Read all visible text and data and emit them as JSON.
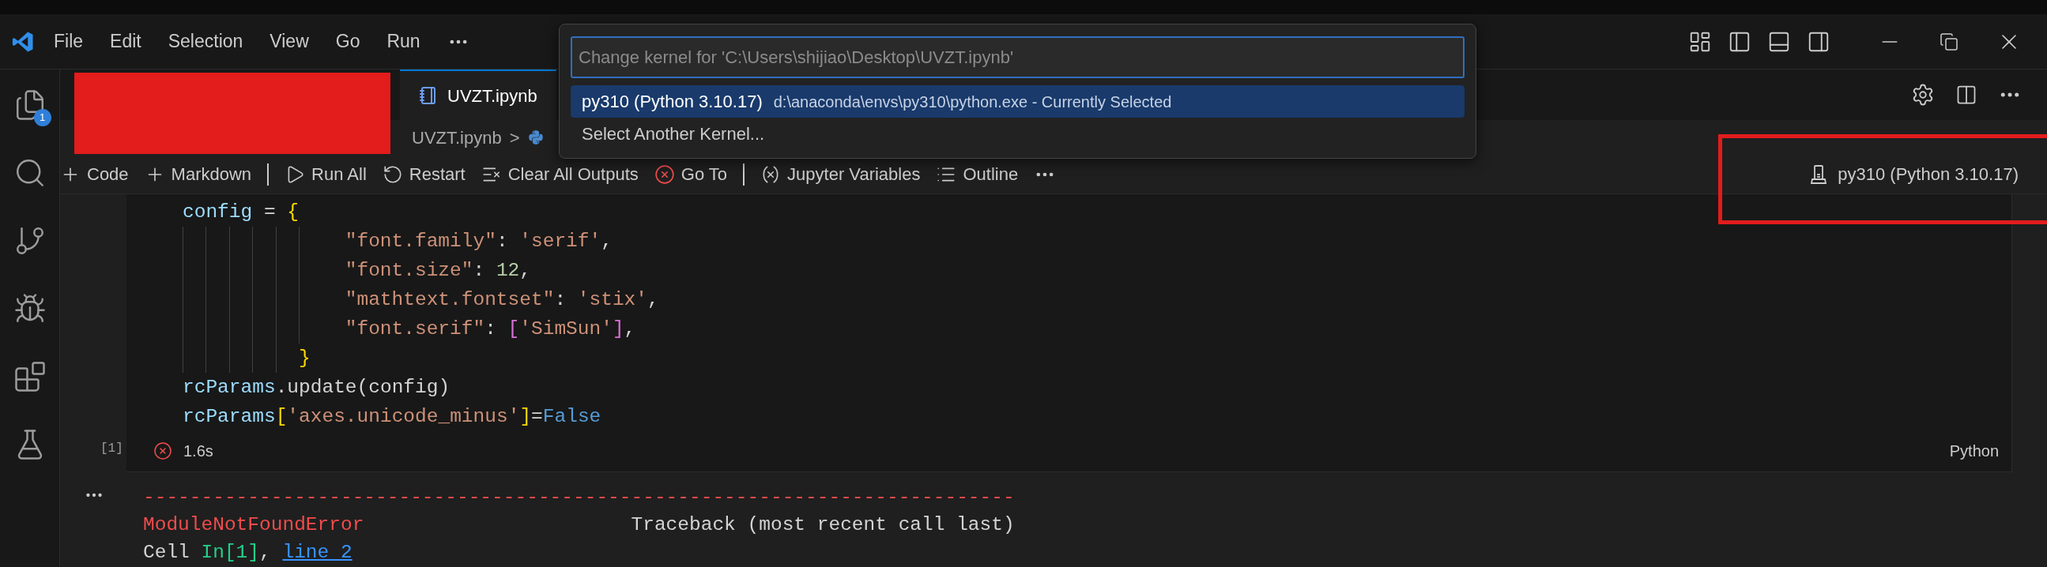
{
  "menu": [
    "File",
    "Edit",
    "Selection",
    "View",
    "Go",
    "Run"
  ],
  "activity_bar": {
    "badge": "1"
  },
  "tab": {
    "label": "UVZT.ipynb",
    "selected": true
  },
  "breadcrumb": [
    "UVZT.ipynb",
    ">"
  ],
  "toolbar": [
    {
      "kind": "button",
      "label": "Code"
    },
    {
      "kind": "button",
      "label": "Markdown"
    },
    {
      "kind": "separator"
    },
    {
      "kind": "button",
      "label": "Run All"
    },
    {
      "kind": "button",
      "label": "Restart"
    },
    {
      "kind": "button",
      "label": "Clear All Outputs"
    },
    {
      "kind": "button",
      "label": "Go To"
    },
    {
      "kind": "separator"
    },
    {
      "kind": "button",
      "label": "Jupyter Variables"
    },
    {
      "kind": "button",
      "label": "Outline"
    }
  ],
  "kernel_status": "py310 (Python 3.10.17)",
  "kernel_picker": {
    "placeholder": "Change kernel for 'C:\\Users\\shijiao\\Desktop\\UVZT.ipynb'",
    "items": [
      {
        "label": "py310 (Python 3.10.17)",
        "detail": "d:\\anaconda\\envs\\py310\\python.exe - Currently Selected",
        "selected": true
      },
      {
        "label": "Select Another Kernel...",
        "selected": false
      }
    ]
  },
  "cell": {
    "execution_count": "[1]",
    "result": {
      "kind": "error",
      "duration": "1.6s"
    },
    "language": "Python",
    "lines": [
      {
        "kind": "plain",
        "tokens": [
          {
            "t": "config",
            "kind": "var"
          },
          {
            "t": " = ",
            "kind": "op"
          },
          {
            "t": "{",
            "kind": "brace"
          }
        ]
      },
      {
        "kind": "nested",
        "tokens": [
          {
            "t": "\"font.family\"",
            "kind": "str"
          },
          {
            "t": ": ",
            "kind": "op"
          },
          {
            "t": "'serif'",
            "kind": "str"
          },
          {
            "t": ",",
            "kind": "op"
          }
        ]
      },
      {
        "kind": "nested",
        "tokens": [
          {
            "t": "\"font.size\"",
            "kind": "str"
          },
          {
            "t": ": ",
            "kind": "op"
          },
          {
            "t": "12",
            "kind": "num"
          },
          {
            "t": ",",
            "kind": "op"
          }
        ]
      },
      {
        "kind": "nested",
        "tokens": [
          {
            "t": "\"mathtext.fontset\"",
            "kind": "str"
          },
          {
            "t": ": ",
            "kind": "op"
          },
          {
            "t": "'stix'",
            "kind": "str"
          },
          {
            "t": ",",
            "kind": "op"
          }
        ]
      },
      {
        "kind": "nested",
        "tokens": [
          {
            "t": "\"font.serif\"",
            "kind": "str"
          },
          {
            "t": ": ",
            "kind": "op"
          },
          {
            "t": "[",
            "kind": "bracket"
          },
          {
            "t": "'SimSun'",
            "kind": "str"
          },
          {
            "t": "]",
            "kind": "bracket"
          },
          {
            "t": ",",
            "kind": "op"
          }
        ]
      },
      {
        "kind": "closing",
        "tokens": [
          {
            "t": "}",
            "kind": "brace"
          }
        ]
      },
      {
        "kind": "plain",
        "tokens": [
          {
            "t": "rcParams",
            "kind": "var"
          },
          {
            "t": ".update(config)",
            "kind": "op"
          }
        ]
      },
      {
        "kind": "plain",
        "tokens": [
          {
            "t": "rcParams",
            "kind": "var"
          },
          {
            "t": "[",
            "kind": "brace"
          },
          {
            "t": "'axes.unicode_minus'",
            "kind": "str"
          },
          {
            "t": "]",
            "kind": "brace"
          },
          {
            "t": "=",
            "kind": "op"
          },
          {
            "t": "False",
            "kind": "kw"
          }
        ]
      }
    ]
  },
  "output": {
    "rule": "---------------------------------------------------------------------------",
    "error_name": "ModuleNotFoundError",
    "traceback": "Traceback (most recent call last)",
    "location": {
      "prefix": "Cell ",
      "cell": "In[1]",
      "separator": ", ",
      "line": "line 2"
    }
  },
  "redaction": true,
  "highlight_frame": true
}
